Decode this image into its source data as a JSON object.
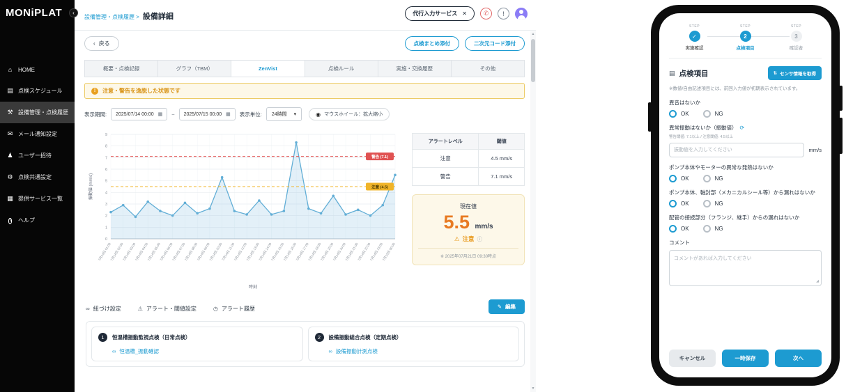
{
  "colors": {
    "primary": "#1d9bd1",
    "value_orange": "#e87a22",
    "warning_red": "#e05252",
    "caution_yellow": "#f0b429"
  },
  "icons": {
    "check": "✓",
    "home": "⌂",
    "calendar": "▤",
    "wrench": "⚒",
    "mail": "✉",
    "user": "♟",
    "gear": "⚙",
    "services": "▦",
    "help": "?",
    "collapse": "‹",
    "back": "‹",
    "close": "✕",
    "alert": "!",
    "warning": "⚠",
    "info": "ⓘ",
    "calendar_small": "▦",
    "dropdown": "▾",
    "mouse": "◉",
    "link": "∞",
    "bell": "⚠",
    "clock": "◷",
    "edit": "✎",
    "clipboard": "▤",
    "sensor": "⇅",
    "refresh": "⟳",
    "phone_glyph": "✆",
    "resize": "◢",
    "scroll_up": "▲",
    "scroll_down": "▼"
  },
  "brand": {
    "logo": "MONiPLAT"
  },
  "sidebar": {
    "items": [
      {
        "label": "HOME"
      },
      {
        "label": "点検スケジュール"
      },
      {
        "label": "設備管理・点検履歴"
      },
      {
        "label": "メール通知設定"
      },
      {
        "label": "ユーザー招待"
      },
      {
        "label": "点検共通設定"
      },
      {
        "label": "提供サービス一覧"
      },
      {
        "label": "ヘルプ"
      }
    ]
  },
  "header": {
    "breadcrumb_parent": "設備管理・点検履歴 >",
    "breadcrumb_current": "設備詳細",
    "proxy_service_button": "代行入力サービス"
  },
  "toolbar": {
    "back_button": "戻る",
    "attach_summary_button": "点検まとめ添付",
    "attach_qr_button": "二次元コード添付"
  },
  "tabs": [
    {
      "label": "概要・点検記録"
    },
    {
      "label": "グラフ（TBM）"
    },
    {
      "label": "ZenVist"
    },
    {
      "label": "点検ルール"
    },
    {
      "label": "実施・交換履歴"
    },
    {
      "label": "その他"
    }
  ],
  "alert_banner": "注意・警告を逸脱した状態です",
  "controls": {
    "period_label": "表示期間:",
    "date_from": "2025/07/14 00:00",
    "date_to": "2025/07/15 00:00",
    "tilde": "~",
    "unit_label": "表示単位:",
    "unit_value": "24時間",
    "mouse_hint": "マウスホイール：拡大縮小"
  },
  "chart_data": {
    "type": "line",
    "xlabel": "時刻",
    "ylabel": "振動値 (mm/s)",
    "ylim": [
      0,
      9
    ],
    "grid": true,
    "line_color": "#62aed6",
    "x": [
      "7月14日 01:00",
      "7月14日 02:00",
      "7月14日 03:00",
      "7月14日 04:00",
      "7月14日 05:00",
      "7月14日 06:00",
      "7月14日 07:00",
      "7月14日 08:00",
      "7月14日 09:00",
      "7月14日 10:00",
      "7月14日 11:00",
      "7月14日 12:00",
      "7月14日 13:00",
      "7月14日 14:00",
      "7月14日 15:00",
      "7月14日 16:00",
      "7月14日 17:00",
      "7月14日 18:00",
      "7月14日 19:00",
      "7月14日 20:00",
      "7月14日 21:00",
      "7月14日 22:00",
      "7月14日 23:00",
      "7月15日 00:00"
    ],
    "values": [
      2.3,
      2.9,
      1.9,
      3.2,
      2.4,
      2.0,
      3.1,
      2.2,
      2.6,
      5.3,
      2.4,
      2.1,
      3.3,
      2.1,
      2.4,
      8.3,
      2.6,
      2.2,
      3.7,
      2.1,
      2.5,
      2.0,
      2.9,
      5.5
    ],
    "thresholds": [
      {
        "label": "警告",
        "value": 7.1,
        "color": "#e05252",
        "text_color": "#ffffff"
      },
      {
        "label": "注意",
        "value": 4.5,
        "color": "#f0b429",
        "text_color": "#4a3a00"
      }
    ]
  },
  "alert_table": {
    "headers": [
      "アラートレベル",
      "閾値"
    ],
    "rows": [
      [
        "注意",
        "4.5 mm/s"
      ],
      [
        "警告",
        "7.1 mm/s"
      ]
    ]
  },
  "current_value": {
    "label": "現在値",
    "value": "5.5",
    "unit": "mm/s",
    "status": "注意",
    "timestamp": "※ 2025年07月21日 09:30時点"
  },
  "link_tabs": {
    "items": [
      {
        "label": "紐づけ設定"
      },
      {
        "label": "アラート・閾値設定"
      },
      {
        "label": "アラート履歴"
      }
    ],
    "edit_button": "編集"
  },
  "linked_inspections": [
    {
      "number": "1",
      "title": "恒温槽振動監視点検（日常点検）",
      "link": "恒温槽_振動確認"
    },
    {
      "number": "2",
      "title": "設備振動総合点検（定期点検）",
      "link": "設備振動計測点検"
    }
  ],
  "phone": {
    "steps": [
      {
        "step": "STEP",
        "label": "実施確認"
      },
      {
        "step": "STEP",
        "num": "2",
        "label": "点検項目"
      },
      {
        "step": "STEP",
        "num": "3",
        "label": "確認者"
      }
    ],
    "title": "点検項目",
    "sensor_button": "センサ情報を取得",
    "note": "※数値/自由記述項目には、前回入力値が初期表示されています。",
    "ok_label": "OK",
    "ng_label": "NG",
    "questions": [
      {
        "text": "異音はないか"
      },
      {
        "text": "異常振動はないか（振動値）",
        "hint": "警告閾値: 7.1以上 / 注意閾値: 4.5以上",
        "placeholder": "振動値を入力してください",
        "unit": "mm/s"
      },
      {
        "text": "ポンプ本体やモーターの異常な発熱はないか"
      },
      {
        "text": "ポンプ本体、軸封部（メカニカルシール等）から漏れはないか"
      },
      {
        "text": "配管の接続部分（フランジ、継手）からの漏れはないか"
      }
    ],
    "comment_label": "コメント",
    "comment_placeholder": "コメントがあれば入力してください",
    "footer": {
      "cancel": "キャンセル",
      "save": "一時保存",
      "next": "次へ"
    }
  }
}
